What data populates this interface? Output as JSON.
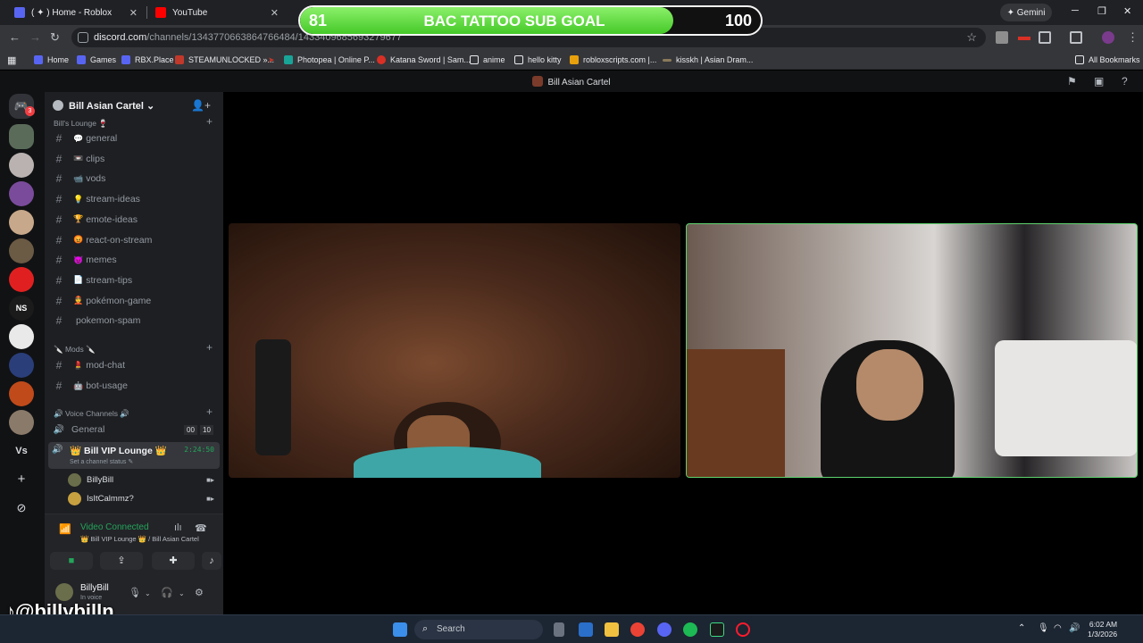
{
  "browser": {
    "tabs": [
      {
        "title": "( ✦ ) Home - Roblox"
      },
      {
        "title": "YouTube"
      }
    ],
    "gemini_label": "Gemini",
    "url_host": "discord.com",
    "url_path": "/channels/1343770663864766484/1433409685693279677",
    "bookmarks": [
      "Home",
      "Games",
      "RBX.Place",
      "STEAMUNLOCKED »...",
      "Photopea | Online P...",
      "Katana Sword | Sam...",
      "anime",
      "hello kitty",
      "robloxscripts.com |...",
      "kisskh | Asian Dram...",
      "All Bookmarks"
    ]
  },
  "goal": {
    "current": "81",
    "title": "BAC TATTOO SUB GOAL",
    "target": "100",
    "progress_fraction": 0.81
  },
  "discord": {
    "top_title": "Bill Asian Cartel",
    "rail_badge": "3",
    "rail_vs": "Vs",
    "rail_ns": "NS",
    "server_name": "Bill Asian Cartel",
    "categories": {
      "lounge": "Bill's Lounge 🍷",
      "mods": "🔪 Mods 🔪",
      "voice": "🔊 Voice Channels 🔊"
    },
    "text_channels": [
      {
        "emoji": "💬",
        "name": "general"
      },
      {
        "emoji": "📼",
        "name": "clips"
      },
      {
        "emoji": "📹",
        "name": "vods"
      },
      {
        "emoji": "💡",
        "name": "stream-ideas"
      },
      {
        "emoji": "🏆",
        "name": "emote-ideas"
      },
      {
        "emoji": "😡",
        "name": "react-on-stream"
      },
      {
        "emoji": "😈",
        "name": "memes"
      },
      {
        "emoji": "📄",
        "name": "stream-tips"
      },
      {
        "emoji": "👲",
        "name": "pokémon-game"
      },
      {
        "emoji": "",
        "name": "pokemon-spam"
      }
    ],
    "mod_channels": [
      {
        "emoji": "💄",
        "name": "mod-chat"
      },
      {
        "emoji": "🤖",
        "name": "bot-usage"
      }
    ],
    "voice_general": {
      "name": "General",
      "count_a": "00",
      "count_b": "10"
    },
    "vip_channel": {
      "name": "👑 Bill VIP Lounge 👑",
      "status": "Set a channel status ✎",
      "timer": "2:24:50"
    },
    "voice_users": [
      "BillyBill",
      "IsItCalmmz?"
    ],
    "voice_panel": {
      "status": "Video Connected",
      "location": "👑 Bill VIP Lounge 👑 / Bill Asian Cartel"
    },
    "user": {
      "name": "BillyBill",
      "status": "In voice"
    }
  },
  "watermark": "@billybilln",
  "taskbar": {
    "search_placeholder": "Search",
    "time": "6:02 AM",
    "date": "1/3/2026"
  },
  "colors": {
    "goal_fill": "#45c928",
    "voice_green": "#23a55a",
    "discord_bg": "#1e1f22"
  }
}
